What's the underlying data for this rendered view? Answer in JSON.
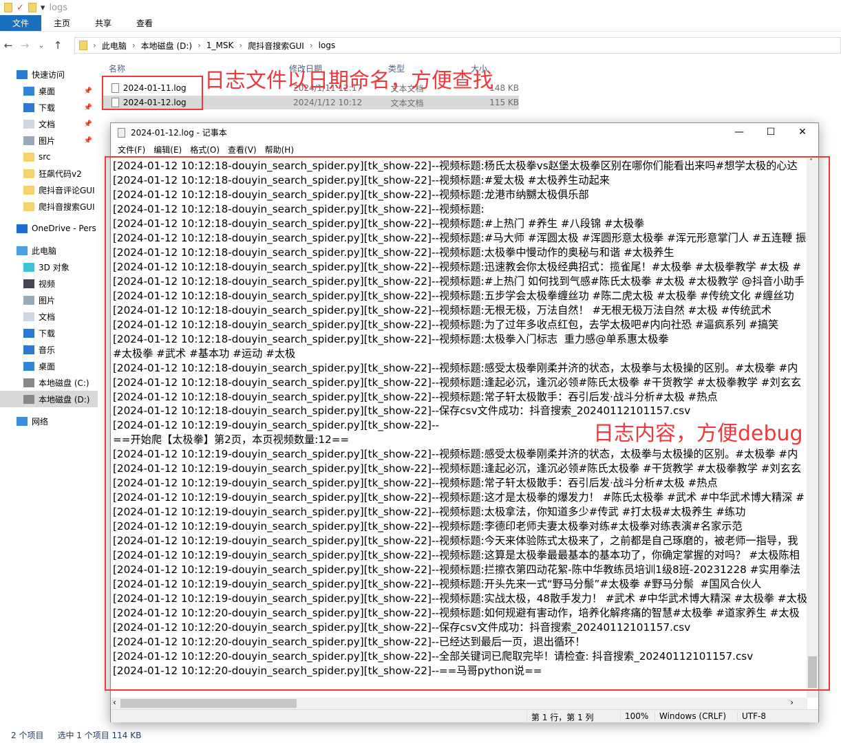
{
  "explorer": {
    "title": "logs",
    "ribbon_tabs": [
      "文件",
      "主页",
      "共享",
      "查看"
    ],
    "breadcrumb": [
      "此电脑",
      "本地磁盘 (D:)",
      "1_MSK",
      "爬抖音搜索GUI",
      "logs"
    ],
    "columns": {
      "name": "名称",
      "modified": "修改日期",
      "type": "类型",
      "size": "大小"
    },
    "files": [
      {
        "name": "2024-01-11.log",
        "modified": "2024/1/11 12:17",
        "type": "文本文档",
        "size": "148 KB"
      },
      {
        "name": "2024-01-12.log",
        "modified": "2024/1/12 10:12",
        "type": "文本文档",
        "size": "115 KB"
      }
    ],
    "nav": [
      {
        "label": "快速访问",
        "icon": "star-icon"
      },
      {
        "label": "桌面",
        "icon": "desktop-icon",
        "pinned": true
      },
      {
        "label": "下载",
        "icon": "download-icon",
        "pinned": true
      },
      {
        "label": "文档",
        "icon": "document-icon",
        "pinned": true
      },
      {
        "label": "图片",
        "icon": "picture-icon",
        "pinned": true
      },
      {
        "label": "src",
        "icon": "folder-icon"
      },
      {
        "label": "狂飙代码v2",
        "icon": "folder-icon"
      },
      {
        "label": "爬抖音评论GUI",
        "icon": "folder-icon"
      },
      {
        "label": "爬抖音搜索GUI",
        "icon": "folder-icon"
      },
      {
        "label": "OneDrive - Pers",
        "icon": "cloud-icon"
      },
      {
        "label": "此电脑",
        "icon": "computer-icon"
      },
      {
        "label": "3D 对象",
        "icon": "cube-icon"
      },
      {
        "label": "视频",
        "icon": "video-icon"
      },
      {
        "label": "图片",
        "icon": "picture-icon"
      },
      {
        "label": "文档",
        "icon": "document-icon"
      },
      {
        "label": "下载",
        "icon": "download-icon"
      },
      {
        "label": "音乐",
        "icon": "music-icon"
      },
      {
        "label": "桌面",
        "icon": "desktop-icon"
      },
      {
        "label": "本地磁盘 (C:)",
        "icon": "drive-icon"
      },
      {
        "label": "本地磁盘 (D:)",
        "icon": "drive-icon",
        "selected": true
      },
      {
        "label": "网络",
        "icon": "network-icon"
      }
    ],
    "status": {
      "count": "2 个项目",
      "selected": "选中 1 个项目  114 KB"
    }
  },
  "notepad": {
    "title": "2024-01-12.log - 记事本",
    "menu": [
      "文件(F)",
      "编辑(E)",
      "格式(O)",
      "查看(V)",
      "帮助(H)"
    ],
    "lines": [
      "[2024-01-12 10:12:18-douyin_search_spider.py][tk_show-22]--视频标题:杨氏太极拳vs赵堡太极拳区别在哪你们能看出来吗#想学太极的心达",
      "[2024-01-12 10:12:18-douyin_search_spider.py][tk_show-22]--视频标题:#爱太极 #太极养生动起来",
      "[2024-01-12 10:12:18-douyin_search_spider.py][tk_show-22]--视频标题:龙港市纳嬲太极俱乐部",
      "[2024-01-12 10:12:18-douyin_search_spider.py][tk_show-22]--视频标题:",
      "[2024-01-12 10:12:18-douyin_search_spider.py][tk_show-22]--视频标题:#上热门 #养生 #八段锦 #太极拳",
      "[2024-01-12 10:12:18-douyin_search_spider.py][tk_show-22]--视频标题:#马大师 #浑圆太极 #浑圆形意太极拳 #浑元形意掌门人 #五连鞭 振",
      "[2024-01-12 10:12:18-douyin_search_spider.py][tk_show-22]--视频标题:太极拳中慢动作的奥秘与和谐 #太极养生",
      "[2024-01-12 10:12:18-douyin_search_spider.py][tk_show-22]--视频标题:迅速教会你太极经典招式：揽雀尾！#太极拳 #太极拳教学 #太极 #",
      "[2024-01-12 10:12:18-douyin_search_spider.py][tk_show-22]--视频标题:#上热门 如何找到气感#陈氏太极拳 #太极 #太极教学 @抖音小助手",
      "[2024-01-12 10:12:18-douyin_search_spider.py][tk_show-22]--视频标题:五步学会太极拳缠丝功 #陈二虎太极 #太极拳 #传统文化 #缠丝功",
      "[2024-01-12 10:12:18-douyin_search_spider.py][tk_show-22]--视频标题:无根无极，万法自然！ #无根无极万法自然 #太极 #传统武术",
      "[2024-01-12 10:12:18-douyin_search_spider.py][tk_show-22]--视频标题:为了过年多收点红包，去学太极吧#内向社恐 #逼疯系列 #搞笑",
      "[2024-01-12 10:12:18-douyin_search_spider.py][tk_show-22]--视频标题:太极拳入门标志  重力感@单系惠太极拳",
      "#太极拳 #武术 #基本功 #运动 #太极",
      "[2024-01-12 10:12:18-douyin_search_spider.py][tk_show-22]--视频标题:感受太极拳刚柔并济的状态，太极拳与太极操的区别。#太极拳 #内",
      "[2024-01-12 10:12:18-douyin_search_spider.py][tk_show-22]--视频标题:逢起必沉，逢沉必领#陈氏太极拳 #干货教学 #太极拳教学 #刘玄玄",
      "[2024-01-12 10:12:18-douyin_search_spider.py][tk_show-22]--视频标题:常子轩太极散手：吞引后发·战斗分析#太极 #热点",
      "[2024-01-12 10:12:18-douyin_search_spider.py][tk_show-22]--保存csv文件成功：抖音搜索_20240112101157.csv",
      "[2024-01-12 10:12:19-douyin_search_spider.py][tk_show-22]--",
      "==开始爬【太极拳】第2页，本页视频数量:12==",
      "[2024-01-12 10:12:19-douyin_search_spider.py][tk_show-22]--视频标题:感受太极拳刚柔并济的状态，太极拳与太极操的区别。#太极拳 #内",
      "[2024-01-12 10:12:19-douyin_search_spider.py][tk_show-22]--视频标题:逢起必沉，逢沉必领#陈氏太极拳 #干货教学 #太极拳教学 #刘玄玄",
      "[2024-01-12 10:12:19-douyin_search_spider.py][tk_show-22]--视频标题:常子轩太极散手：吞引后发·战斗分析#太极 #热点",
      "[2024-01-12 10:12:19-douyin_search_spider.py][tk_show-22]--视频标题:这才是太极拳的爆发力！ #陈氏太极拳 #武术 #中华武术博大精深 #",
      "[2024-01-12 10:12:19-douyin_search_spider.py][tk_show-22]--视频标题:太极拿法，你知道多少#传武 #打太极#太极养生 #练功",
      "[2024-01-12 10:12:19-douyin_search_spider.py][tk_show-22]--视频标题:李德印老师夫妻太极拳对练#太极拳对练表演#名家示范",
      "[2024-01-12 10:12:19-douyin_search_spider.py][tk_show-22]--视频标题:今天来体验陈式太极来了，之前都是自己琢磨的，被老师一指导，我",
      "[2024-01-12 10:12:19-douyin_search_spider.py][tk_show-22]--视频标题:这算是太极拳最最基本的基本功了，你确定掌握的对吗？ #太极陈相",
      "[2024-01-12 10:12:19-douyin_search_spider.py][tk_show-22]--视频标题:拦擦衣第四动花絮-陈中华教练员培训1级8班-20231228 #实用拳法",
      "[2024-01-12 10:12:19-douyin_search_spider.py][tk_show-22]--视频标题:开头先来一式“野马分鬃”#太极拳 #野马分鬃  #国风合伙人",
      "[2024-01-12 10:12:19-douyin_search_spider.py][tk_show-22]--视频标题:实战太极，48散手发力！ #武术 #中华武术博大精深 #太极拳 #太极",
      "[2024-01-12 10:12:20-douyin_search_spider.py][tk_show-22]--视频标题:如何规避有害动作，培养化解疼痛的智慧#太极拳 #道家养生 #太极",
      "[2024-01-12 10:12:20-douyin_search_spider.py][tk_show-22]--保存csv文件成功：抖音搜索_20240112101157.csv",
      "[2024-01-12 10:12:20-douyin_search_spider.py][tk_show-22]--已经达到最后一页，退出循环！",
      "[2024-01-12 10:12:20-douyin_search_spider.py][tk_show-22]--全部关键词已爬取完毕！请检查: 抖音搜索_20240112101157.csv",
      "[2024-01-12 10:12:20-douyin_search_spider.py][tk_show-22]--==马哥python说=="
    ],
    "status": {
      "position": "第 1 行，第 1 列",
      "zoom": "100%",
      "line_ending": "Windows (CRLF)",
      "encoding": "UTF-8"
    }
  },
  "annotations": {
    "filename_note": "日志文件以日期命名，方便查找",
    "content_note": "日志内容，方便debug",
    "color": "#f0383c"
  }
}
